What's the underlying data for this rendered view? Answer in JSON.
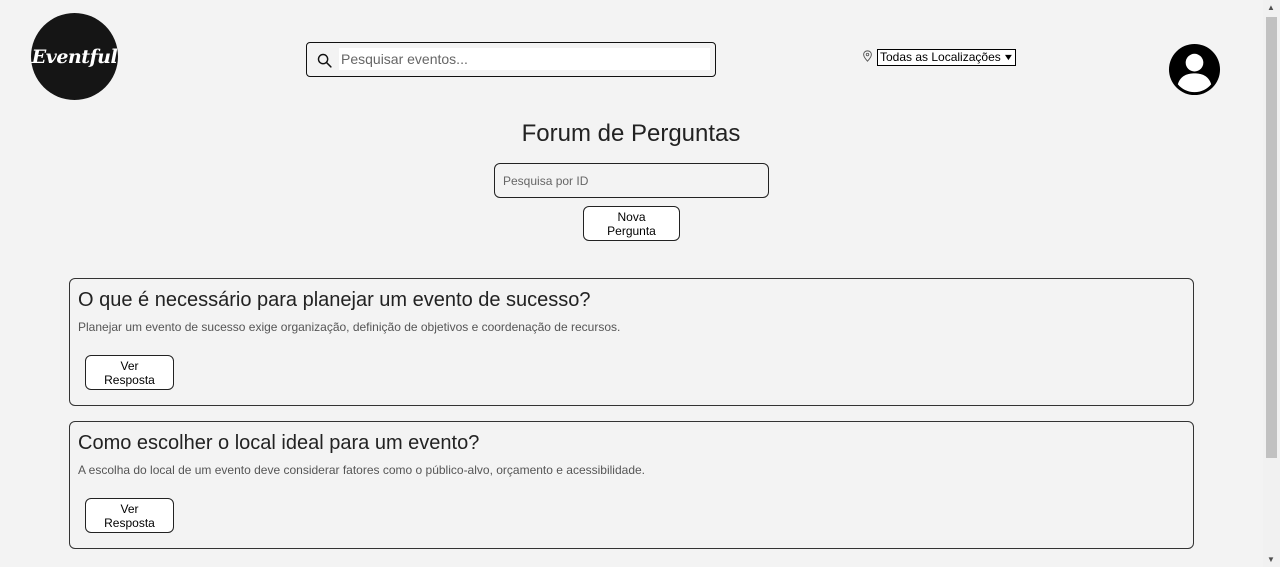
{
  "header": {
    "logo_text": "Eventful",
    "search_placeholder": "Pesquisar eventos...",
    "location_selected": "Todas as Localizações"
  },
  "main": {
    "title": "Forum de Perguntas",
    "id_search_placeholder": "Pesquisa por ID",
    "new_question_label": "Nova Pergunta",
    "questions": [
      {
        "title": "O que é necessário para planejar um evento de sucesso?",
        "summary": "Planejar um evento de sucesso exige organização, definição de objetivos e coordenação de recursos.",
        "button_label": "Ver Resposta"
      },
      {
        "title": "Como escolher o local ideal para um evento?",
        "summary": "A escolha do local de um evento deve considerar fatores como o público-alvo, orçamento e acessibilidade.",
        "button_label": "Ver Resposta"
      }
    ]
  },
  "icons": {
    "search": "search-icon",
    "location": "map-pin-icon",
    "dropdown": "chevron-down-icon",
    "user": "user-avatar-icon"
  },
  "colors": {
    "background": "#f3f3f3",
    "logo_bg": "#151515",
    "border": "#222222"
  }
}
